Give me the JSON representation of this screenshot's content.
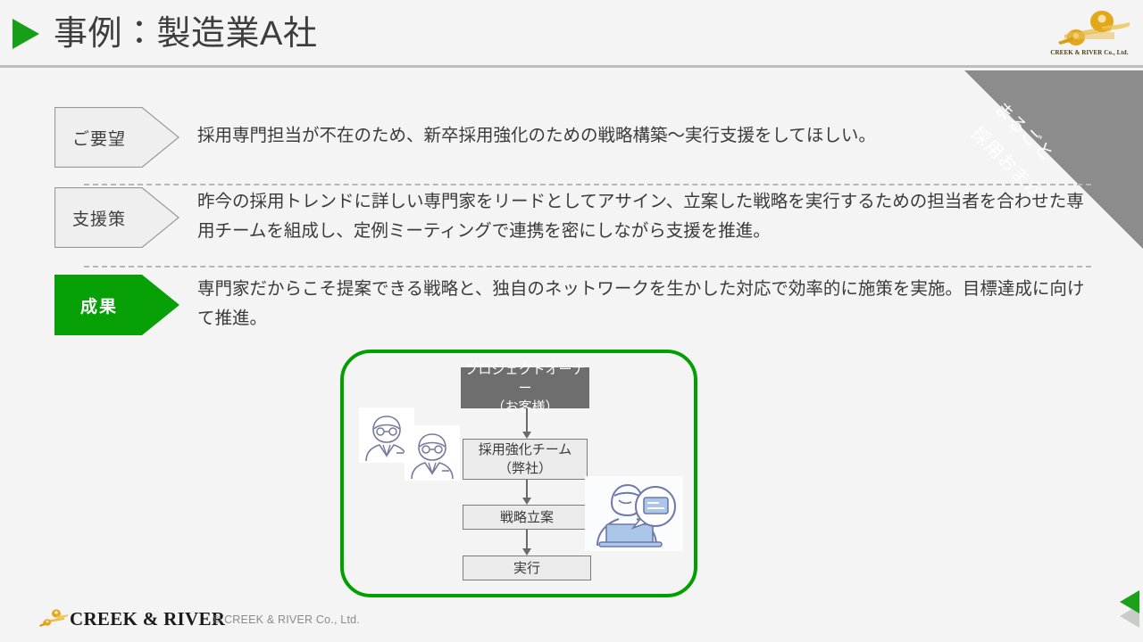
{
  "header": {
    "title": "事例：製造業A社",
    "bullet_icon": "play-triangle-icon",
    "logo": {
      "mark_icon": "creek-river-mark-icon",
      "caption": "CREEK & RIVER Co., Ltd."
    }
  },
  "ribbon": {
    "line1": "まるごと",
    "line2": "採用おまかせ",
    "color": "#8c8c8c"
  },
  "rows": [
    {
      "label": "ご要望",
      "text": "採用専門担当が不在のため、新卒採用強化のための戦略構築〜実行支援をしてほしい。",
      "accent": "#efefef"
    },
    {
      "label": "支援策",
      "text": "昨今の採用トレンドに詳しい専門家をリードとしてアサイン、立案した戦略を実行するための担当者を合わせた専用チームを組成し、定例ミーティングで連携を密にしながら支援を推進。",
      "accent": "#efefef"
    },
    {
      "label": "成果",
      "text": "専門家だからこそ提案できる戦略と、独自のネットワークを生かした対応で効率的に施策を実施。目標達成に向けて推進。",
      "accent": "#07a007"
    }
  ],
  "diagram": {
    "frame_color": "#00a000",
    "boxes": [
      {
        "line1": "プロジェクトオーナー",
        "line2": "（お客様）",
        "fill": "#6e6e6e"
      },
      {
        "line1": "採用強化チーム",
        "line2": "（弊社）",
        "fill": "#ebebeb"
      },
      {
        "line1": "戦略立案",
        "line2": "",
        "fill": "#ebebeb"
      },
      {
        "line1": "実行",
        "line2": "",
        "fill": "#ebebeb"
      }
    ],
    "illustrations": [
      {
        "name": "business-person-icon"
      },
      {
        "name": "business-person-icon"
      },
      {
        "name": "person-at-laptop-icon"
      }
    ]
  },
  "footer": {
    "brand": "CREEK & RIVER",
    "copyright": "© CREEK & RIVER Co., Ltd.",
    "nav": {
      "prev_icon": "prev-arrow-icon",
      "next_icon": "next-arrow-icon"
    }
  }
}
